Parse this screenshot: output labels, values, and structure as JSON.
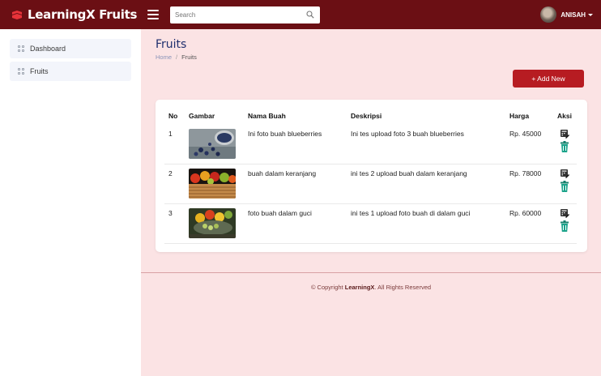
{
  "header": {
    "brand": "LearningX Fruits",
    "search_placeholder": "Search",
    "user_name": "ANISAH"
  },
  "sidebar": {
    "items": [
      {
        "label": "Dashboard"
      },
      {
        "label": "Fruits"
      }
    ]
  },
  "page": {
    "title": "Fruits",
    "breadcrumb": {
      "home": "Home",
      "separator": "/",
      "current": "Fruits"
    },
    "add_button": "+ Add New"
  },
  "table": {
    "headers": [
      "No",
      "Gambar",
      "Nama Buah",
      "Deskripsi",
      "Harga",
      "Aksi"
    ],
    "rows": [
      {
        "no": "1",
        "nama": "Ini foto buah blueberries",
        "deskripsi": "Ini tes upload foto 3 buah blueberries",
        "harga": "Rp. 45000"
      },
      {
        "no": "2",
        "nama": "buah dalam keranjang",
        "deskripsi": "ini tes 2 upload buah dalam keranjang",
        "harga": "Rp. 78000"
      },
      {
        "no": "3",
        "nama": "foto buah dalam guci",
        "deskripsi": "ini tes 1 upload foto buah di dalam guci",
        "harga": "Rp. 60000"
      }
    ]
  },
  "footer": {
    "prefix": "© Copyright",
    "brand": "LearningX",
    "suffix": ". All Rights Reserved"
  },
  "colors": {
    "topbar": "#6b0f14",
    "accent_button": "#b71c22",
    "page_bg": "#fbe3e4",
    "delete_icon": "#1aa38a"
  },
  "icons": [
    "hamburger-icon",
    "search-icon",
    "dashboard-grid-icon",
    "edit-icon",
    "trash-icon"
  ]
}
